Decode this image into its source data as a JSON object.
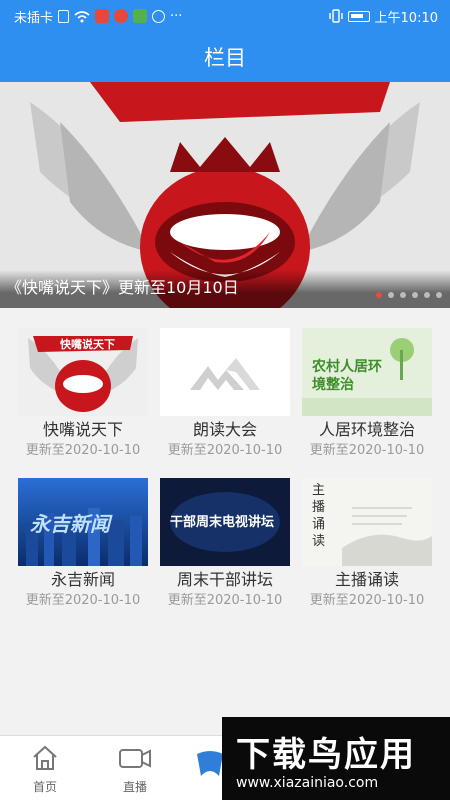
{
  "status_bar": {
    "carrier": "未插卡",
    "time": "上午10:10",
    "more": "···"
  },
  "header": {
    "title": "栏目"
  },
  "banner": {
    "caption": "《快嘴说天下》更新至10月10日",
    "dots_count": 6,
    "active_dot": 0
  },
  "programs": [
    {
      "title": "快嘴说天下",
      "updated": "更新至2020-10-10",
      "thumb_text": "快嘴说天下"
    },
    {
      "title": "朗读大会",
      "updated": "更新至2020-10-10",
      "thumb_text": ""
    },
    {
      "title": "人居环境整治",
      "updated": "更新至2020-10-10",
      "thumb_text": "农村人居环境整治"
    },
    {
      "title": "永吉新闻",
      "updated": "更新至2020-10-10",
      "thumb_text": "永吉新闻"
    },
    {
      "title": "周末干部讲坛",
      "updated": "更新至2020-10-10",
      "thumb_text": "干部周末电视讲坛"
    },
    {
      "title": "主播诵读",
      "updated": "更新至2020-10-10",
      "thumb_text": "主播诵读"
    }
  ],
  "bottom_nav": {
    "items": [
      {
        "label": "首页",
        "icon": "home-icon"
      },
      {
        "label": "直播",
        "icon": "video-camera-icon"
      }
    ]
  },
  "watermark": {
    "title": "下载鸟应用",
    "url": "www.xiazainiao.com"
  }
}
